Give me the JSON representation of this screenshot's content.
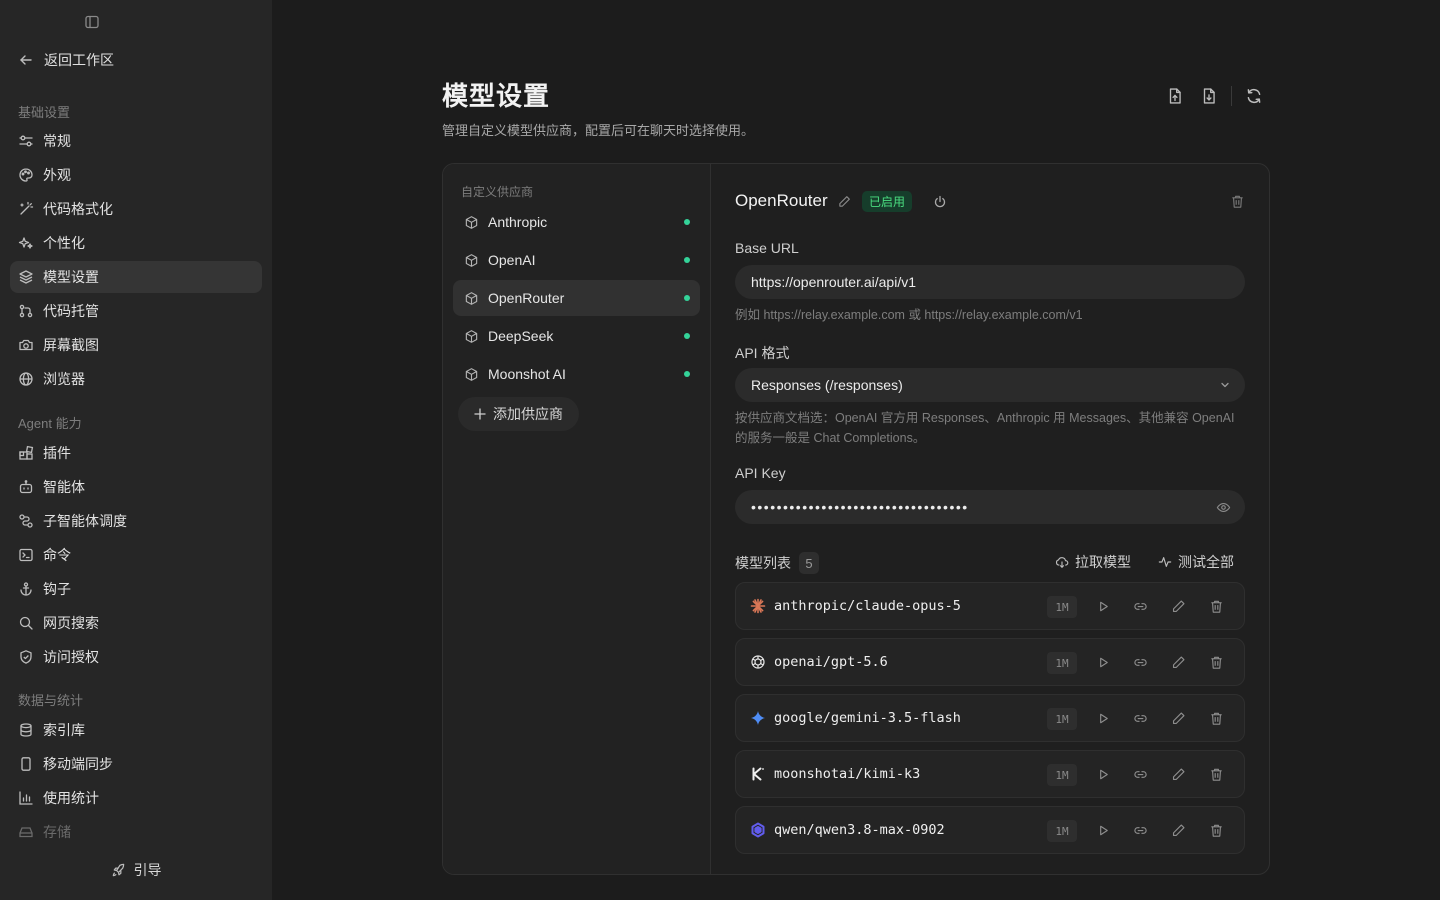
{
  "sidebar": {
    "back_label": "返回工作区",
    "sections": [
      {
        "label": "基础设置",
        "items": [
          "常规",
          "外观",
          "代码格式化",
          "个性化",
          "模型设置",
          "代码托管",
          "屏幕截图",
          "浏览器"
        ]
      },
      {
        "label": "Agent 能力",
        "items": [
          "插件",
          "智能体",
          "子智能体调度",
          "命令",
          "钩子",
          "网页搜索",
          "访问授权"
        ]
      },
      {
        "label": "数据与统计",
        "items": [
          "索引库",
          "移动端同步",
          "使用统计",
          "存储"
        ]
      }
    ],
    "active_item": "模型设置",
    "guide_label": "引导"
  },
  "header": {
    "title": "模型设置",
    "subtitle": "管理自定义模型供应商，配置后可在聊天时选择使用。"
  },
  "providers": {
    "label": "自定义供应商",
    "items": [
      {
        "name": "Anthropic",
        "enabled": true
      },
      {
        "name": "OpenAI",
        "enabled": true
      },
      {
        "name": "OpenRouter",
        "enabled": true,
        "active": true
      },
      {
        "name": "DeepSeek",
        "enabled": true
      },
      {
        "name": "Moonshot AI",
        "enabled": true
      }
    ],
    "add_label": "添加供应商"
  },
  "detail": {
    "name": "OpenRouter",
    "status_badge": "已启用",
    "base_url_label": "Base URL",
    "base_url_value": "https://openrouter.ai/api/v1",
    "base_url_hint": "例如 https://relay.example.com 或 https://relay.example.com/v1",
    "api_format_label": "API 格式",
    "api_format_value": "Responses (/responses)",
    "api_format_hint": "按供应商文档选：OpenAI 官方用 Responses、Anthropic 用 Messages、其他兼容 OpenAI 的服务一般是 Chat Completions。",
    "api_key_label": "API Key",
    "api_key_value": "••••••••••••••••••••••••••••••••••",
    "models_label": "模型列表",
    "models_count": "5",
    "fetch_label": "拉取模型",
    "test_all_label": "测试全部",
    "models": [
      {
        "id": "anthropic/claude-opus-5",
        "ctx": "1M",
        "logo": "anthropic-icon"
      },
      {
        "id": "openai/gpt-5.6",
        "ctx": "1M",
        "logo": "openai-icon"
      },
      {
        "id": "google/gemini-3.5-flash",
        "ctx": "1M",
        "logo": "gemini-icon"
      },
      {
        "id": "moonshotai/kimi-k3",
        "ctx": "1M",
        "logo": "kimi-icon"
      },
      {
        "id": "qwen/qwen3.8-max-0902",
        "ctx": "1M",
        "logo": "qwen-icon"
      }
    ]
  },
  "colors": {
    "accent_green": "#34d399",
    "badge_bg": "#163d2b",
    "anthropic": "#d97757",
    "gemini": "#4f8df5",
    "qwen": "#615ced"
  }
}
